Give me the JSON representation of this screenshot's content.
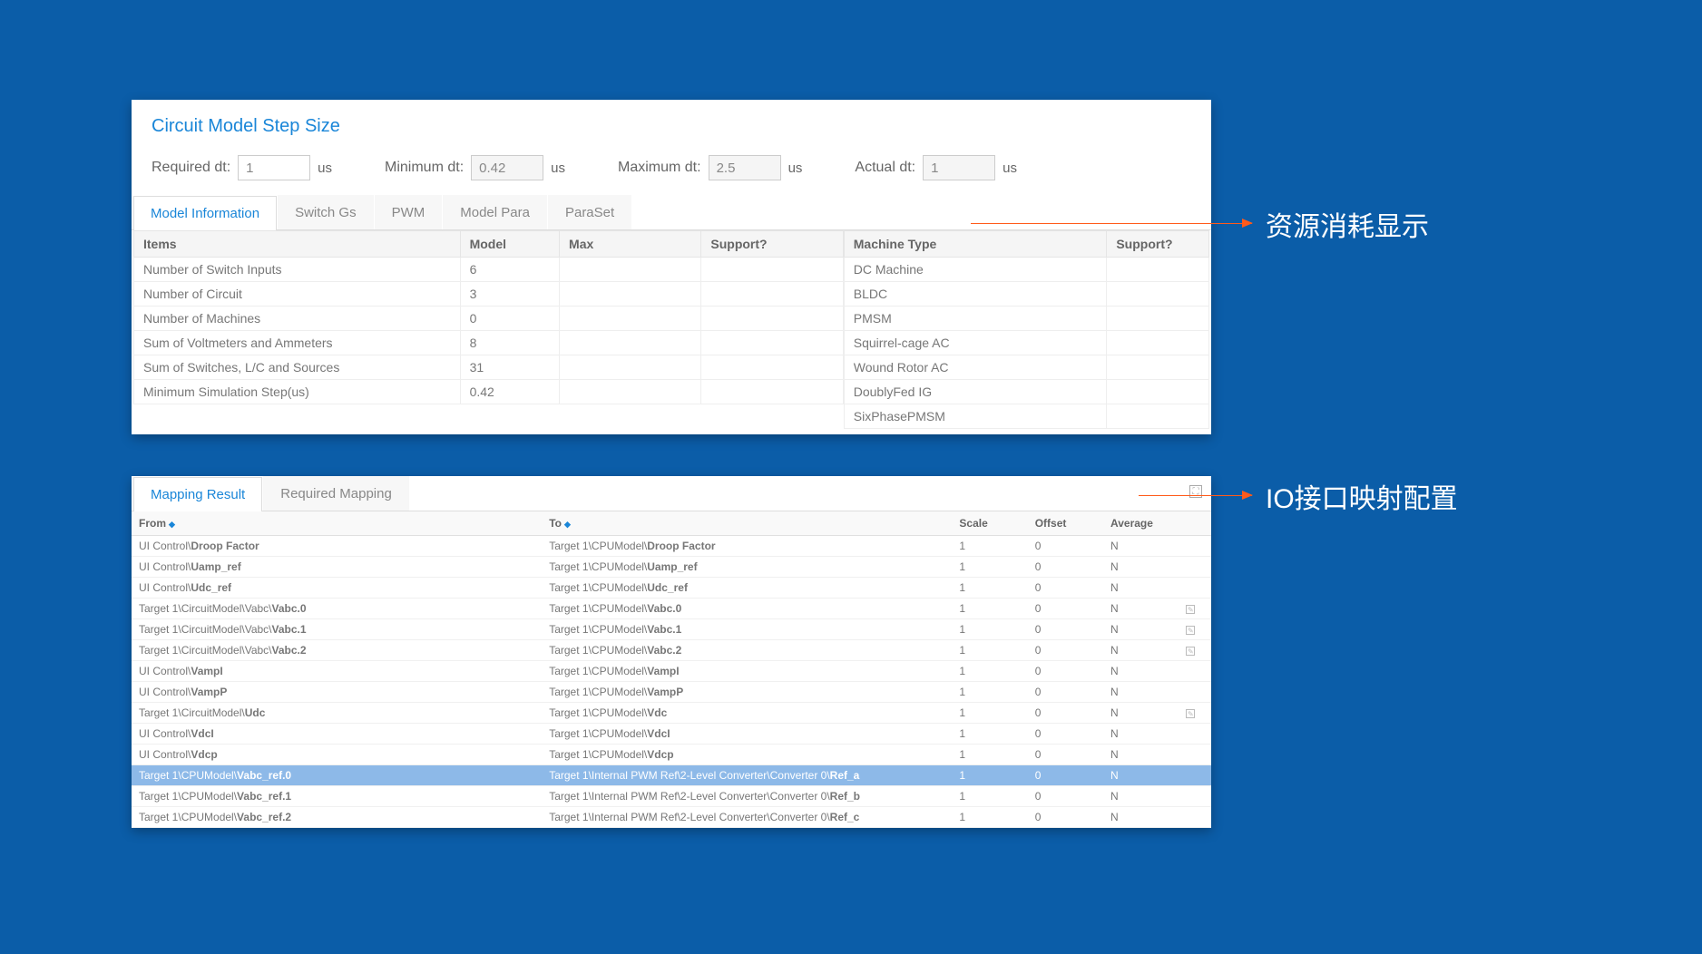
{
  "annotations": {
    "resource": "资源消耗显示",
    "io_mapping": "IO接口映射配置"
  },
  "panel1": {
    "title": "Circuit Model Step Size",
    "steps": {
      "required_label": "Required dt:",
      "required_value": "1",
      "min_label": "Minimum dt:",
      "min_value": "0.42",
      "max_label": "Maximum dt:",
      "max_value": "2.5",
      "actual_label": "Actual dt:",
      "actual_value": "1",
      "unit": "us"
    },
    "tabs": [
      "Model Information",
      "Switch Gs",
      "PWM",
      "Model Para",
      "ParaSet"
    ],
    "left_headers": {
      "items": "Items",
      "model": "Model",
      "max": "Max",
      "support": "Support?"
    },
    "left_rows": [
      {
        "items": "Number of Switch Inputs",
        "model": "6",
        "max": "",
        "support": ""
      },
      {
        "items": "Number of Circuit",
        "model": "3",
        "max": "",
        "support": ""
      },
      {
        "items": "Number of Machines",
        "model": "0",
        "max": "",
        "support": ""
      },
      {
        "items": "Sum of Voltmeters and Ammeters",
        "model": "8",
        "max": "",
        "support": ""
      },
      {
        "items": "Sum of Switches, L/C and Sources",
        "model": "31",
        "max": "",
        "support": ""
      },
      {
        "items": "Minimum Simulation Step(us)",
        "model": "0.42",
        "max": "",
        "support": ""
      }
    ],
    "right_headers": {
      "machine": "Machine Type",
      "support": "Support?"
    },
    "right_rows": [
      {
        "machine": "DC Machine",
        "support": ""
      },
      {
        "machine": "BLDC",
        "support": ""
      },
      {
        "machine": "PMSM",
        "support": ""
      },
      {
        "machine": "Squirrel-cage AC",
        "support": ""
      },
      {
        "machine": "Wound Rotor AC",
        "support": ""
      },
      {
        "machine": "DoublyFed IG",
        "support": ""
      },
      {
        "machine": "SixPhasePMSM",
        "support": ""
      }
    ]
  },
  "panel2": {
    "tabs": [
      "Mapping Result",
      "Required Mapping"
    ],
    "headers": {
      "from": "From",
      "to": "To",
      "scale": "Scale",
      "offset": "Offset",
      "average": "Average"
    },
    "rows": [
      {
        "from_pre": "UI Control\\",
        "from_bold": "Droop Factor",
        "to_pre": "Target 1\\CPUModel\\",
        "to_bold": "Droop Factor",
        "scale": "1",
        "offset": "0",
        "avg": "N",
        "edit": false,
        "sel": false
      },
      {
        "from_pre": "UI Control\\",
        "from_bold": "Uamp_ref",
        "to_pre": "Target 1\\CPUModel\\",
        "to_bold": "Uamp_ref",
        "scale": "1",
        "offset": "0",
        "avg": "N",
        "edit": false,
        "sel": false
      },
      {
        "from_pre": "UI Control\\",
        "from_bold": "Udc_ref",
        "to_pre": "Target 1\\CPUModel\\",
        "to_bold": "Udc_ref",
        "scale": "1",
        "offset": "0",
        "avg": "N",
        "edit": false,
        "sel": false
      },
      {
        "from_pre": "Target 1\\CircuitModel\\Vabc\\",
        "from_bold": "Vabc.0",
        "to_pre": "Target 1\\CPUModel\\",
        "to_bold": "Vabc.0",
        "scale": "1",
        "offset": "0",
        "avg": "N",
        "edit": true,
        "sel": false
      },
      {
        "from_pre": "Target 1\\CircuitModel\\Vabc\\",
        "from_bold": "Vabc.1",
        "to_pre": "Target 1\\CPUModel\\",
        "to_bold": "Vabc.1",
        "scale": "1",
        "offset": "0",
        "avg": "N",
        "edit": true,
        "sel": false
      },
      {
        "from_pre": "Target 1\\CircuitModel\\Vabc\\",
        "from_bold": "Vabc.2",
        "to_pre": "Target 1\\CPUModel\\",
        "to_bold": "Vabc.2",
        "scale": "1",
        "offset": "0",
        "avg": "N",
        "edit": true,
        "sel": false
      },
      {
        "from_pre": "UI Control\\",
        "from_bold": "VampI",
        "to_pre": "Target 1\\CPUModel\\",
        "to_bold": "VampI",
        "scale": "1",
        "offset": "0",
        "avg": "N",
        "edit": false,
        "sel": false
      },
      {
        "from_pre": "UI Control\\",
        "from_bold": "VampP",
        "to_pre": "Target 1\\CPUModel\\",
        "to_bold": "VampP",
        "scale": "1",
        "offset": "0",
        "avg": "N",
        "edit": false,
        "sel": false
      },
      {
        "from_pre": "Target 1\\CircuitModel\\",
        "from_bold": "Udc",
        "to_pre": "Target 1\\CPUModel\\",
        "to_bold": "Vdc",
        "scale": "1",
        "offset": "0",
        "avg": "N",
        "edit": true,
        "sel": false
      },
      {
        "from_pre": "UI Control\\",
        "from_bold": "VdcI",
        "to_pre": "Target 1\\CPUModel\\",
        "to_bold": "VdcI",
        "scale": "1",
        "offset": "0",
        "avg": "N",
        "edit": false,
        "sel": false
      },
      {
        "from_pre": "UI Control\\",
        "from_bold": "Vdcp",
        "to_pre": "Target 1\\CPUModel\\",
        "to_bold": "Vdcp",
        "scale": "1",
        "offset": "0",
        "avg": "N",
        "edit": false,
        "sel": false
      },
      {
        "from_pre": "Target 1\\CPUModel\\",
        "from_bold": "Vabc_ref.0",
        "to_pre": "Target 1\\Internal PWM Ref\\2-Level Converter\\Converter 0\\",
        "to_bold": "Ref_a",
        "scale": "1",
        "offset": "0",
        "avg": "N",
        "edit": false,
        "sel": true
      },
      {
        "from_pre": "Target 1\\CPUModel\\",
        "from_bold": "Vabc_ref.1",
        "to_pre": "Target 1\\Internal PWM Ref\\2-Level Converter\\Converter 0\\",
        "to_bold": "Ref_b",
        "scale": "1",
        "offset": "0",
        "avg": "N",
        "edit": false,
        "sel": false
      },
      {
        "from_pre": "Target 1\\CPUModel\\",
        "from_bold": "Vabc_ref.2",
        "to_pre": "Target 1\\Internal PWM Ref\\2-Level Converter\\Converter 0\\",
        "to_bold": "Ref_c",
        "scale": "1",
        "offset": "0",
        "avg": "N",
        "edit": false,
        "sel": false
      }
    ]
  }
}
